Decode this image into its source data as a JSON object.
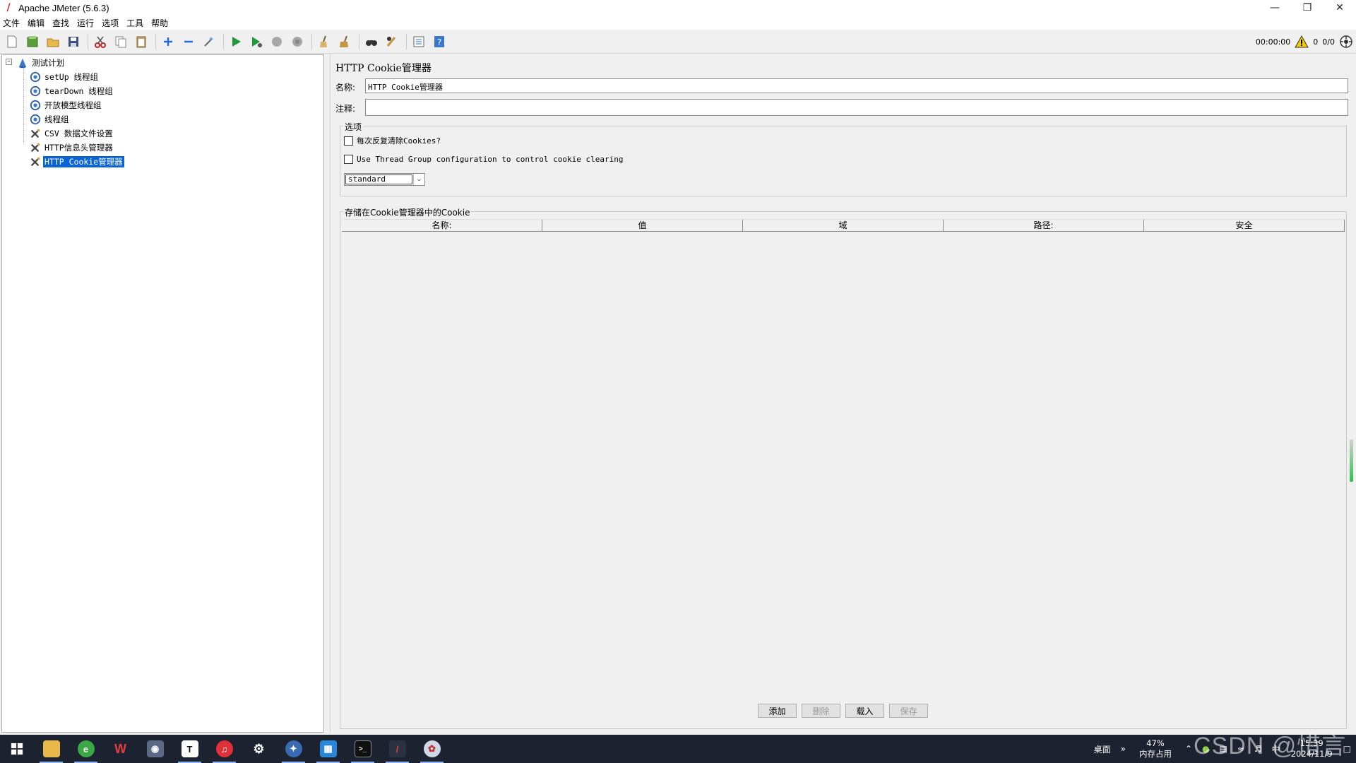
{
  "window": {
    "title": "Apache JMeter (5.6.3)"
  },
  "menu": [
    "文件",
    "编辑",
    "查找",
    "运行",
    "选项",
    "工具",
    "帮助"
  ],
  "toolbar_status": {
    "timer": "00:00:00",
    "warnings": "0",
    "threads": "0/0"
  },
  "tree": {
    "root": "测试计划",
    "items": [
      {
        "label": "setUp 线程组",
        "icon": "thread-group-icon"
      },
      {
        "label": "tearDown 线程组",
        "icon": "thread-group-icon"
      },
      {
        "label": "开放模型线程组",
        "icon": "thread-group-icon"
      },
      {
        "label": "线程组",
        "icon": "thread-group-icon"
      },
      {
        "label": "CSV 数据文件设置",
        "icon": "config-element-icon"
      },
      {
        "label": "HTTP信息头管理器",
        "icon": "config-element-icon"
      },
      {
        "label": "HTTP Cookie管理器",
        "icon": "config-element-icon",
        "selected": true
      }
    ]
  },
  "panel": {
    "title": "HTTP Cookie管理器",
    "name_label": "名称:",
    "name_value": "HTTP Cookie管理器",
    "comment_label": "注释:",
    "comment_value": "",
    "options_legend": "选项",
    "clear_each_iteration": "每次反复清除Cookies?",
    "use_thread_group": "Use Thread Group configuration to control cookie clearing",
    "policy": "standard",
    "cookies_legend": "存储在Cookie管理器中的Cookie",
    "columns": [
      "名称:",
      "值",
      "域",
      "路径:",
      "安全"
    ],
    "buttons": {
      "add": "添加",
      "delete": "删除",
      "load": "载入",
      "save": "保存"
    }
  },
  "taskbar": {
    "desktop": "桌面",
    "memory_pct": "47%",
    "memory_label": "内存占用",
    "ime": "中",
    "time": "15:39",
    "date": "2024/11/9"
  },
  "watermark": "CSDN @惜言"
}
